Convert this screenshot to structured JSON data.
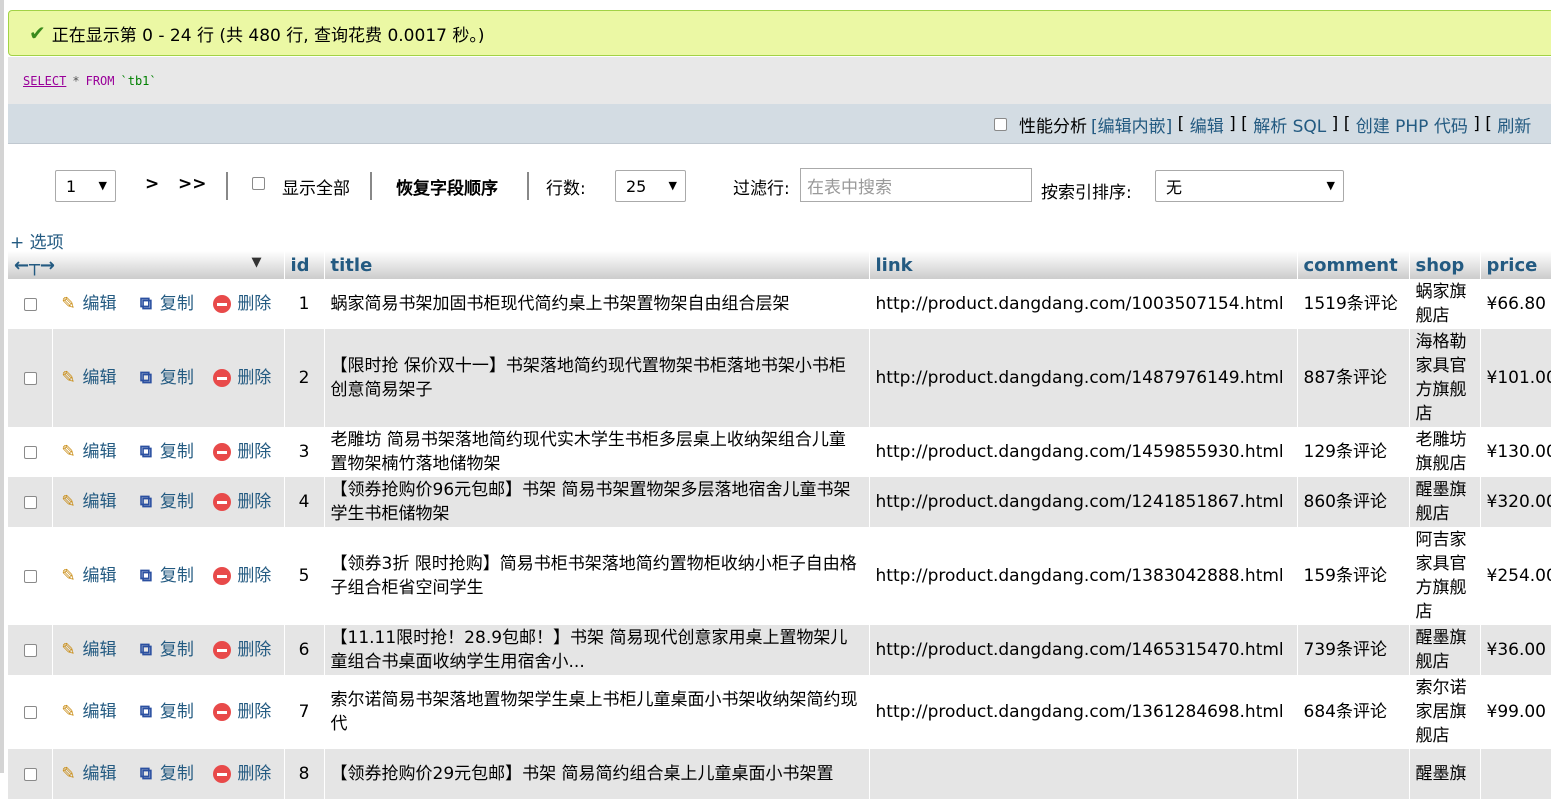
{
  "message": "正在显示第 0 - 24 行 (共 480 行, 查询花费 0.0017 秒。)",
  "sql": {
    "select": "SELECT",
    "star": "*",
    "from": "FROM",
    "table": "`tb1`"
  },
  "tools": {
    "profiling": "性能分析",
    "edit_inline": "[编辑内嵌]",
    "edit": "编辑",
    "explain": "解析 SQL",
    "create_php": "创建 PHP 代码",
    "refresh": "刷新"
  },
  "nav": {
    "page": "1",
    "next": ">",
    "last": ">>",
    "show_all": "显示全部",
    "restore_order": "恢复字段顺序",
    "rows_label": "行数:",
    "rows_value": "25",
    "filter_label": "过滤行:",
    "filter_placeholder": "在表中搜索",
    "sort_label": "按索引排序:",
    "sort_value": "无"
  },
  "options_link": "+ 选项",
  "columns": [
    "id",
    "title",
    "link",
    "comment",
    "shop",
    "price"
  ],
  "actions": {
    "edit": "编辑",
    "copy": "复制",
    "delete": "删除"
  },
  "rows": [
    {
      "id": "1",
      "title": "蜗家简易书架加固书柜现代简约桌上书架置物架自由组合层架",
      "link": "http://product.dangdang.com/1003507154.html",
      "comment": "1519条评论",
      "shop": "蜗家旗舰店",
      "price": "¥66.80"
    },
    {
      "id": "2",
      "title": "【限时抢 保价双十一】书架落地简约现代置物架书柜落地书架小书柜创意简易架子",
      "link": "http://product.dangdang.com/1487976149.html",
      "comment": "887条评论",
      "shop": "海格勒家具官方旗舰店",
      "price": "¥101.00"
    },
    {
      "id": "3",
      "title": "老雕坊 简易书架落地简约现代实木学生书柜多层桌上收纳架组合儿童置物架楠竹落地储物架",
      "link": "http://product.dangdang.com/1459855930.html",
      "comment": "129条评论",
      "shop": "老雕坊旗舰店",
      "price": "¥130.00"
    },
    {
      "id": "4",
      "title": "【领券抢购价96元包邮】书架 简易书架置物架多层落地宿舍儿童书架学生书柜储物架",
      "link": "http://product.dangdang.com/1241851867.html",
      "comment": "860条评论",
      "shop": "醒墨旗舰店",
      "price": "¥320.00"
    },
    {
      "id": "5",
      "title": "【领券3折 限时抢购】简易书柜书架落地简约置物柜收纳小柜子自由格子组合柜省空间学生",
      "link": "http://product.dangdang.com/1383042888.html",
      "comment": "159条评论",
      "shop": "阿吉家家具官方旗舰店",
      "price": "¥254.00"
    },
    {
      "id": "6",
      "title": "【11.11限时抢！28.9包邮！】书架 简易现代创意家用桌上置物架儿童组合书桌面收纳学生用宿舍小...",
      "link": "http://product.dangdang.com/1465315470.html",
      "comment": "739条评论",
      "shop": "醒墨旗舰店",
      "price": "¥36.00"
    },
    {
      "id": "7",
      "title": "索尔诺简易书架落地置物架学生桌上书柜儿童桌面小书架收纳架简约现代",
      "link": "http://product.dangdang.com/1361284698.html",
      "comment": "684条评论",
      "shop": "索尔诺家居旗舰店",
      "price": "¥99.00"
    },
    {
      "id": "8",
      "title": "【领券抢购价29元包邮】书架 简易简约组合桌上儿童桌面小书架置",
      "link": "",
      "comment": "",
      "shop": "醒墨旗",
      "price": ""
    }
  ]
}
